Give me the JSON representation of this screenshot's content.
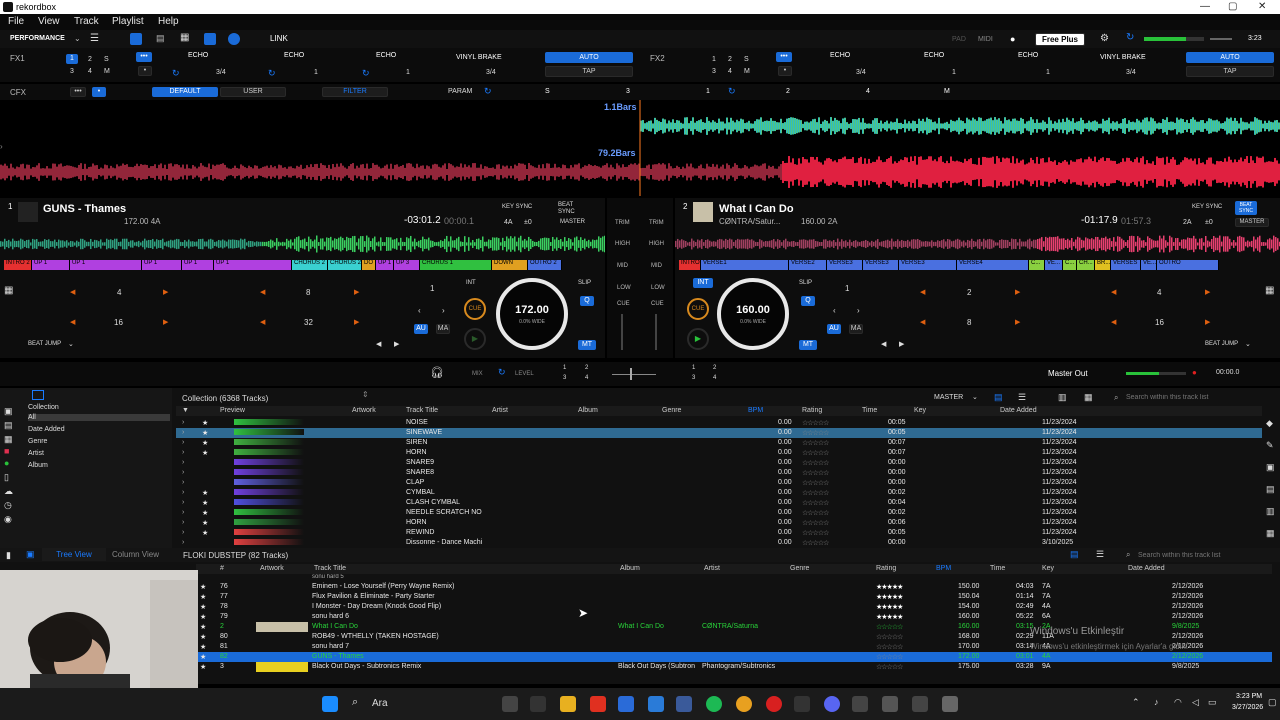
{
  "window": {
    "title": "rekordbox",
    "min": "—",
    "max": "▢",
    "close": "✕"
  },
  "menu": [
    "File",
    "View",
    "Track",
    "Playlist",
    "Help"
  ],
  "toolbar": {
    "mode": "PERFORMANCE",
    "link": "LINK",
    "pad": "PAD",
    "midi": "MIDI",
    "plan": "Free Plus",
    "clock": "3:23"
  },
  "fx": {
    "fx1_label": "FX1",
    "fx2_label": "FX2",
    "fx1_slots": [
      "ECHO",
      "ECHO",
      "ECHO"
    ],
    "fx2_slots": [
      "ECHO",
      "ECHO",
      "ECHO"
    ],
    "fx1_beat": "3/4",
    "fx2_beat": "3/4",
    "vinyl_brake": "VINYL BRAKE",
    "auto": "AUTO",
    "tap": "TAP",
    "beat_nums": [
      "1",
      "2",
      "3",
      "4",
      "M"
    ],
    "fx1_vals": [
      "3/4",
      "1",
      "1"
    ],
    "fx2_vals": [
      "3/4",
      "1",
      "1"
    ]
  },
  "cfx": {
    "label": "CFX",
    "default": "DEFAULT",
    "user": "USER",
    "filter": "FILTER",
    "param": "PARAM",
    "slots": [
      "S",
      "3",
      "1",
      "2",
      "4",
      "M"
    ]
  },
  "waves": {
    "bars_top": "1.1Bars",
    "bars_bottom": "79.2Bars"
  },
  "deck1": {
    "num": "1",
    "title": "GUNS - Thames",
    "bpm_key": "172.00  4A",
    "time_remain": "-03:01.2",
    "time_elapsed": "00:00.1",
    "key_sync": "KEY SYNC",
    "beat_sync": "BEAT SYNC",
    "key_val": "4A",
    "key_off": "±0",
    "master": "MASTER",
    "platter_bpm": "172.00",
    "platter_pct": "0.0%  WIDE",
    "cue": "CUE",
    "int": "INT",
    "slip": "SLIP",
    "q": "Q",
    "au": "AU",
    "ma": "MA",
    "mt": "MT",
    "loop_num": "1",
    "beat_jump": "BEAT JUMP",
    "pads": [
      "4",
      "8",
      "16",
      "32"
    ],
    "cues": [
      {
        "label": "INTRO 2",
        "color": "#e53030",
        "w": 28
      },
      {
        "label": "UP 1",
        "color": "#b040e0",
        "w": 38
      },
      {
        "label": "UP 1",
        "color": "#b040e0",
        "w": 72
      },
      {
        "label": "UP 1",
        "color": "#b040e0",
        "w": 40
      },
      {
        "label": "UP 1",
        "color": "#b040e0",
        "w": 32
      },
      {
        "label": "UP 1",
        "color": "#b040e0",
        "w": 78
      },
      {
        "label": "CHORUS 2",
        "color": "#3ad0d0",
        "w": 36
      },
      {
        "label": "CHORUS 2",
        "color": "#3ad0d0",
        "w": 34
      },
      {
        "label": "DO",
        "color": "#e0a020",
        "w": 14
      },
      {
        "label": "UP 1",
        "color": "#b040e0",
        "w": 18
      },
      {
        "label": "UP 3",
        "color": "#b040e0",
        "w": 26
      },
      {
        "label": "CHORUS 1",
        "color": "#30c040",
        "w": 72
      },
      {
        "label": "DOWN",
        "color": "#e0a020",
        "w": 36
      },
      {
        "label": "OUTRO 2",
        "color": "#4a70e0",
        "w": 34
      }
    ]
  },
  "deck2": {
    "num": "2",
    "title": "What I Can Do",
    "artist": "CØNTRA/Satur...",
    "bpm_key": "160.00  2A",
    "time_remain": "-01:17.9",
    "time_elapsed": "01:57.3",
    "key_sync": "KEY SYNC",
    "beat_sync": "BEAT SYNC",
    "key_val": "2A",
    "key_off": "±0",
    "master": "MASTER",
    "platter_bpm": "160.00",
    "platter_pct": "0.0%  WIDE",
    "cue": "CUE",
    "int": "INT",
    "slip": "SLIP",
    "q": "Q",
    "au": "AU",
    "ma": "MA",
    "mt": "MT",
    "loop_num": "1",
    "beat_jump": "BEAT JUMP",
    "pads": [
      "2",
      "4",
      "8",
      "16"
    ],
    "cues": [
      {
        "label": "INTRO",
        "color": "#e53030",
        "w": 22
      },
      {
        "label": "VERSE1",
        "color": "#4a70e0",
        "w": 88
      },
      {
        "label": "VERSE2",
        "color": "#4a70e0",
        "w": 38
      },
      {
        "label": "VERSE3",
        "color": "#4a70e0",
        "w": 36
      },
      {
        "label": "VERSE3",
        "color": "#4a70e0",
        "w": 36
      },
      {
        "label": "VERSE3",
        "color": "#4a70e0",
        "w": 58
      },
      {
        "label": "VERSE4",
        "color": "#4a70e0",
        "w": 72
      },
      {
        "label": "C...",
        "color": "#8ad040",
        "w": 16
      },
      {
        "label": "VE...",
        "color": "#4a70e0",
        "w": 18
      },
      {
        "label": "C...",
        "color": "#8ad040",
        "w": 14
      },
      {
        "label": "CH...",
        "color": "#8ad040",
        "w": 18
      },
      {
        "label": "BR...",
        "color": "#e0c020",
        "w": 16
      },
      {
        "label": "VERSES",
        "color": "#4a70e0",
        "w": 30
      },
      {
        "label": "VE...",
        "color": "#4a70e0",
        "w": 16
      },
      {
        "label": "OUTRO",
        "color": "#4a70e0",
        "w": 62
      }
    ]
  },
  "mixer": {
    "trim": "TRIM",
    "high": "HIGH",
    "mid": "MID",
    "low": "LOW",
    "cue": "CUE"
  },
  "masterbar": {
    "mix": "MIX",
    "level": "LEVEL",
    "master_out": "Master Out",
    "time": "00:00.0",
    "nums": [
      "1",
      "2",
      "3",
      "4"
    ]
  },
  "browser": {
    "tree_icon": "collection",
    "tree": [
      "Collection",
      "All",
      "Date Added",
      "Genre",
      "Artist",
      "Album"
    ],
    "collection_title": "Collection (6368 Tracks)",
    "master_select": "MASTER",
    "search_placeholder": "Search within this track list",
    "columns": [
      "Preview",
      "Artwork",
      "Track Title",
      "Artist",
      "Album",
      "Genre",
      "BPM",
      "Rating",
      "Time",
      "Key",
      "Date Added"
    ],
    "rows": [
      {
        "star": "★",
        "title": "NOISE",
        "bpm": "0.00",
        "time": "00:05",
        "date": "11/23/2024"
      },
      {
        "star": "★",
        "title": "SINEWAVE",
        "bpm": "0.00",
        "time": "00:05",
        "date": "11/23/2024",
        "sel": true
      },
      {
        "star": "★",
        "title": "SIREN",
        "bpm": "0.00",
        "time": "00:07",
        "date": "11/23/2024"
      },
      {
        "star": "★",
        "title": "HORN",
        "bpm": "0.00",
        "time": "00:07",
        "date": "11/23/2024"
      },
      {
        "star": "",
        "title": "SNARE9",
        "bpm": "0.00",
        "time": "00:00",
        "date": "11/23/2024"
      },
      {
        "star": "",
        "title": "SNARE8",
        "bpm": "0.00",
        "time": "00:00",
        "date": "11/23/2024"
      },
      {
        "star": "",
        "title": "CLAP",
        "bpm": "0.00",
        "time": "00:00",
        "date": "11/23/2024"
      },
      {
        "star": "★",
        "title": "CYMBAL",
        "bpm": "0.00",
        "time": "00:02",
        "date": "11/23/2024"
      },
      {
        "star": "★",
        "title": "CLASH CYMBAL",
        "bpm": "0.00",
        "time": "00:04",
        "date": "11/23/2024"
      },
      {
        "star": "★",
        "title": "NEEDLE SCRATCH NO",
        "bpm": "0.00",
        "time": "00:02",
        "date": "11/23/2024"
      },
      {
        "star": "★",
        "title": "HORN",
        "bpm": "0.00",
        "time": "00:06",
        "date": "11/23/2024"
      },
      {
        "star": "★",
        "title": "REWIND",
        "bpm": "0.00",
        "time": "00:05",
        "date": "11/23/2024"
      },
      {
        "star": "",
        "title": "Dissonne - Dance Machi",
        "bpm": "0.00",
        "time": "00:00",
        "date": "3/10/2025"
      }
    ],
    "tree_view": "Tree View",
    "column_view": "Column View",
    "playlist_title": "FLOKI DUBSTEP (82 Tracks)",
    "pl_columns": [
      "#",
      "Artwork",
      "Track Title",
      "Album",
      "Artist",
      "Genre",
      "Rating",
      "BPM",
      "Time",
      "Key",
      "Date Added"
    ],
    "pl_rows": [
      {
        "num": "76",
        "title": "Eminem - Lose Yourself (Perry Wayne Remix)",
        "album": "",
        "artist": "",
        "bpm": "150.00",
        "time": "04:03",
        "key": "7A",
        "date": "2/12/2026",
        "stars": "★★★★★",
        "w": true
      },
      {
        "num": "77",
        "title": "Flux Pavilion & Eliminate - Party Starter",
        "album": "",
        "artist": "",
        "bpm": "150.04",
        "time": "01:14",
        "key": "7A",
        "date": "2/12/2026",
        "stars": "★★★★★",
        "w": true
      },
      {
        "num": "78",
        "title": "I Monster - Day Dream (Knock Good Flip)",
        "album": "",
        "artist": "",
        "bpm": "154.00",
        "time": "02:49",
        "key": "4A",
        "date": "2/12/2026",
        "stars": "★★★★★",
        "w": true
      },
      {
        "num": "79",
        "title": "sonu hard 6",
        "album": "",
        "artist": "",
        "bpm": "160.00",
        "time": "05:22",
        "key": "6A",
        "date": "2/12/2026",
        "stars": "★★★★★",
        "w": true
      },
      {
        "num": "2",
        "title": "What I Can Do",
        "album": "What I Can Do",
        "artist": "CØNTRA/Saturna",
        "bpm": "160.00",
        "time": "03:15",
        "key": "2A",
        "date": "9/8/2025",
        "stars": "☆☆☆☆☆",
        "g": true
      },
      {
        "num": "80",
        "title": "ROB49 - WTHELLY (TAKEN HOSTAGE)",
        "album": "",
        "artist": "",
        "bpm": "168.00",
        "time": "02:29",
        "key": "11A",
        "date": "2/12/2026",
        "stars": "☆☆☆☆☆"
      },
      {
        "num": "81",
        "title": "sonu hard 7",
        "album": "",
        "artist": "",
        "bpm": "170.00",
        "time": "03:14",
        "key": "4A",
        "date": "2/12/2026",
        "stars": "☆☆☆☆☆"
      },
      {
        "num": "82",
        "title": "GUNS - Thames",
        "album": "",
        "artist": "",
        "bpm": "172.00",
        "time": "03:01",
        "key": "4A",
        "date": "2/12/2026",
        "stars": "☆☆☆☆☆",
        "sel": true
      },
      {
        "num": "3",
        "title": "Black Out Days - Subtronics Remix",
        "album": "Black Out Days (Subtron",
        "artist": "Phantogram/Subtronics",
        "bpm": "175.00",
        "time": "03:28",
        "key": "9A",
        "date": "9/8/2025",
        "stars": "☆☆☆☆☆"
      }
    ],
    "partial_top": "sonu hard 5"
  },
  "watermark": {
    "line1": "Windows'u Etkinleştir",
    "line2": "Windows'u etkinleştirmek için Ayarlar'a gidin."
  },
  "taskbar": {
    "search": "Ara",
    "time": "3:23 PM",
    "date": "3/27/2026"
  }
}
